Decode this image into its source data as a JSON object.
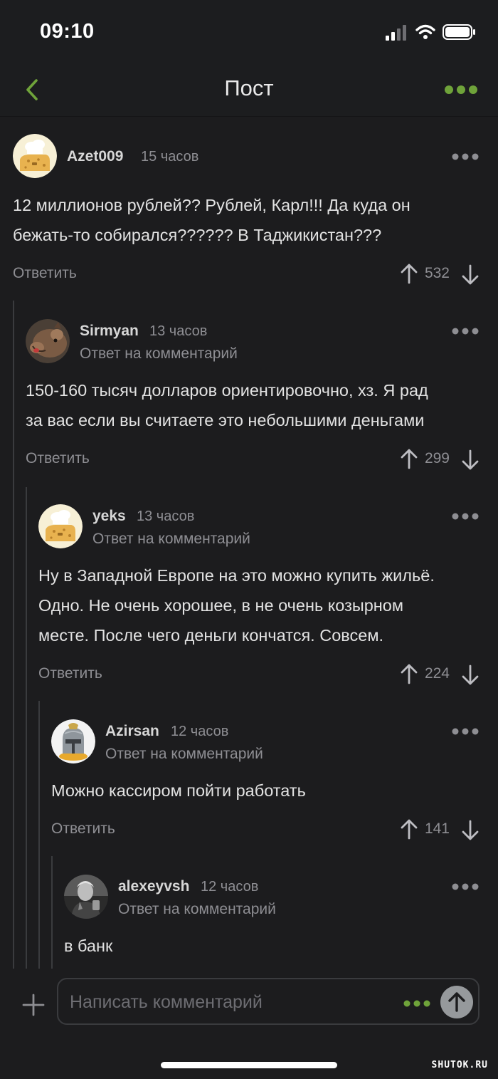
{
  "status_bar": {
    "time": "09:10"
  },
  "nav": {
    "title": "Пост"
  },
  "comments": [
    {
      "author": "Azet009",
      "time": "15 часов",
      "reply_to": "",
      "lines": [
        "12 миллионов рублей?? Рублей, Карл!!!  Да куда он",
        "бежать-то собирался??????  В Таджикистан???"
      ],
      "reply_label": "Ответить",
      "score": "532",
      "avatar": "chef-avatar"
    },
    {
      "author": "Sirmyan",
      "time": "13 часов",
      "reply_to": "Ответ на комментарий",
      "lines": [
        "150-160 тысяч долларов ориентировочно, хз. Я рад",
        "за вас если вы считаете это небольшими деньгами"
      ],
      "reply_label": "Ответить",
      "score": "299",
      "avatar": "animal-avatar"
    },
    {
      "author": "yeks",
      "time": "13 часов",
      "reply_to": "Ответ на комментарий",
      "lines": [
        "Ну в Западной Европе на это можно купить жильё.",
        "Одно. Не очень хорошее, в не очень козырном",
        "месте. После чего деньги кончатся. Совсем."
      ],
      "reply_label": "Ответить",
      "score": "224",
      "avatar": "chef-avatar"
    },
    {
      "author": "Azirsan",
      "time": "12 часов",
      "reply_to": "Ответ на комментарий",
      "lines": [
        "Можно кассиром пойти работать"
      ],
      "reply_label": "Ответить",
      "score": "141",
      "avatar": "helmet-avatar"
    },
    {
      "author": "alexeyvsh",
      "time": "12 часов",
      "reply_to": "Ответ на комментарий",
      "lines": [
        "в банк"
      ],
      "reply_label": "",
      "score": "",
      "avatar": "person-photo-avatar"
    }
  ],
  "compose": {
    "placeholder": "Написать комментарий"
  },
  "watermark": "SHUTOK.RU",
  "colors": {
    "accent": "#6fa33a",
    "background": "#1c1c1e",
    "muted_text": "#8e8e93",
    "thread_line": "#3a3b3e"
  }
}
